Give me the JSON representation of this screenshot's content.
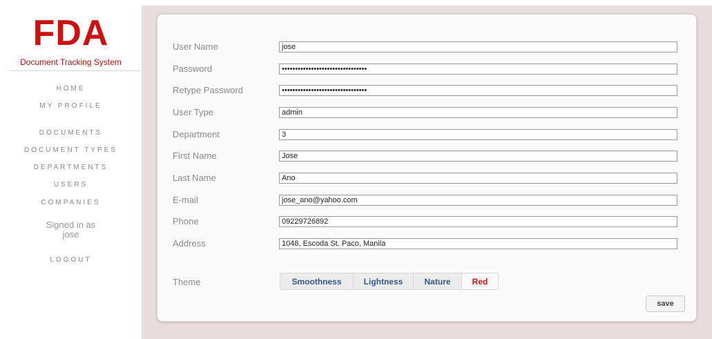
{
  "brand": {
    "logo": "FDA",
    "subtitle": "Document Tracking System"
  },
  "nav": {
    "home": "HOME",
    "my_profile": "MY PROFILE",
    "documents": "DOCUMENTS",
    "document_types": "DOCUMENT TYPES",
    "departments": "DEPARTMENTS",
    "users": "USERS",
    "companies": "COMPANIES",
    "logout": "LOGOUT"
  },
  "session": {
    "signed_in_label": "Signed in as",
    "username": "jose"
  },
  "form": {
    "fields": [
      {
        "label": "User Name",
        "value": "jose"
      },
      {
        "label": "Password",
        "value": "••••••••••••••••••••••••••••••••"
      },
      {
        "label": "Retype Password",
        "value": "••••••••••••••••••••••••••••••••"
      },
      {
        "label": "User Type",
        "value": "admin"
      },
      {
        "label": "Department",
        "value": "3"
      },
      {
        "label": "First Name",
        "value": "Jose"
      },
      {
        "label": "Last Name",
        "value": "Ano"
      },
      {
        "label": "E-mail",
        "value": "jose_ano@yahoo.com"
      },
      {
        "label": "Phone",
        "value": "09229726892"
      },
      {
        "label": "Address",
        "value": "1048, Escoda St. Paco, Manila"
      }
    ],
    "theme_label": "Theme",
    "themes": [
      "Smoothness",
      "Lightness",
      "Nature",
      "Red"
    ],
    "selected_theme": "Red",
    "save_label": "save"
  },
  "colors": {
    "brand_red": "#cc1111",
    "theme_link_blue": "#2f5a8c",
    "page_bg": "#e9dede",
    "nav_text": "#8a8a8a"
  }
}
